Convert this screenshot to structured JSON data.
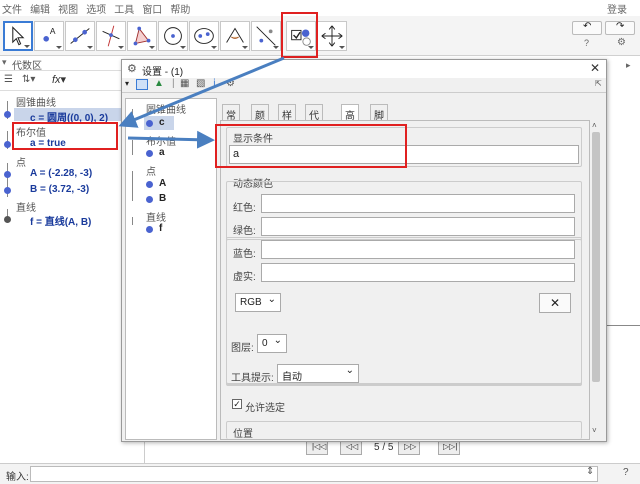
{
  "menu": {
    "items": [
      "文件",
      "编辑",
      "视图",
      "选项",
      "工具",
      "窗口",
      "帮助"
    ],
    "login": "登录"
  },
  "algebra": {
    "header": "代数区",
    "categories": [
      {
        "name": "圆锥曲线",
        "objects": [
          {
            "label": "c = 圆周((0, 0), 2)"
          }
        ]
      },
      {
        "name": "布尔值",
        "objects": [
          {
            "label": "a = true"
          }
        ]
      },
      {
        "name": "点",
        "objects": [
          {
            "label": "A = (-2.28, -3)"
          },
          {
            "label": "B = (3.72, -3)"
          }
        ]
      },
      {
        "name": "直线",
        "objects": [
          {
            "label": "f = 直线(A, B)"
          }
        ]
      }
    ]
  },
  "dialog": {
    "title": "设置 - (1)",
    "tree": {
      "groups": [
        {
          "name": "圆锥曲线",
          "items": [
            "c"
          ]
        },
        {
          "name": "布尔值",
          "items": [
            "a"
          ]
        },
        {
          "name": "点",
          "items": [
            "A",
            "B"
          ]
        },
        {
          "name": "直线",
          "items": [
            "f"
          ]
        }
      ]
    },
    "tabs": [
      "常规",
      "颜色",
      "样式",
      "代数区",
      "高级",
      "脚本"
    ],
    "active_tab": "高级",
    "condition": {
      "title": "显示条件",
      "value": "a"
    },
    "dynamic_color": {
      "title": "动态颜色",
      "red": "红色:",
      "green": "绿色:",
      "blue": "蓝色:",
      "opacity": "虚实:",
      "mode": "RGB",
      "clear": "✕"
    },
    "layer": {
      "label": "图层:",
      "value": "0"
    },
    "tooltip": {
      "label": "工具提示:",
      "value": "自动"
    },
    "allow_selection": {
      "label": "允许选定",
      "checked": true
    },
    "position": {
      "label": "位置"
    }
  },
  "nav": {
    "page": "5 / 5"
  },
  "input": {
    "label": "输入:"
  },
  "colors": {
    "highlight": "#e02020",
    "arrow": "#4a7fc0",
    "object": "#1a3b9c"
  }
}
